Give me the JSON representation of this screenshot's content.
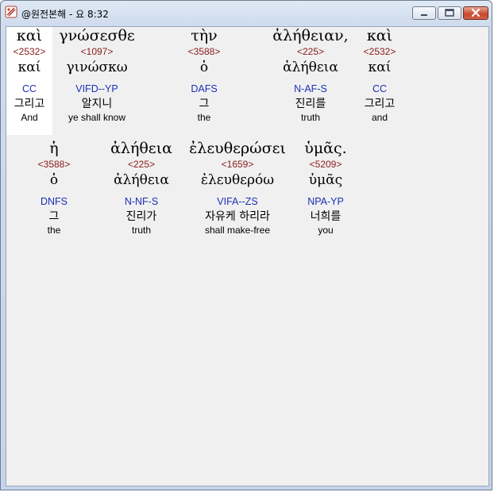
{
  "window": {
    "title": "@원전본해 - 요 8:32"
  },
  "words": [
    {
      "greek": "καὶ",
      "strong": "<2532>",
      "lemma": "καί",
      "morph": "CC",
      "korean": "그리고",
      "english": "And"
    },
    {
      "greek": "γνώσεσθε",
      "strong": "<1097>",
      "lemma": "γινώσκω",
      "morph": "VIFD--YP",
      "korean": "알지니",
      "english": "ye shall know"
    },
    {
      "greek": "τὴν",
      "strong": "<3588>",
      "lemma": "ὁ",
      "morph": "DAFS",
      "korean": "그",
      "english": "the"
    },
    {
      "greek": "ἀλήθειαν,",
      "strong": "<225>",
      "lemma": "ἀλήθεια",
      "morph": "N-AF-S",
      "korean": "진리를",
      "english": "truth"
    },
    {
      "greek": "καὶ",
      "strong": "<2532>",
      "lemma": "καί",
      "morph": "CC",
      "korean": "그리고",
      "english": "and"
    },
    {
      "greek": "ἡ",
      "strong": "<3588>",
      "lemma": "ὁ",
      "morph": "DNFS",
      "korean": "그",
      "english": "the"
    },
    {
      "greek": "ἀλήθεια",
      "strong": "<225>",
      "lemma": "ἀλήθεια",
      "morph": "N-NF-S",
      "korean": "진리가",
      "english": "truth"
    },
    {
      "greek": "ἐλευθερώσει",
      "strong": "<1659>",
      "lemma": "ἐλευθερόω",
      "morph": "VIFA--ZS",
      "korean": "자유케 하리라",
      "english": "shall make-free"
    },
    {
      "greek": "ὑμᾶς.",
      "strong": "<5209>",
      "lemma": "ὑμᾶς",
      "morph": "NPA-YP",
      "korean": "너희를",
      "english": "you"
    }
  ],
  "selected_word_index": 0
}
